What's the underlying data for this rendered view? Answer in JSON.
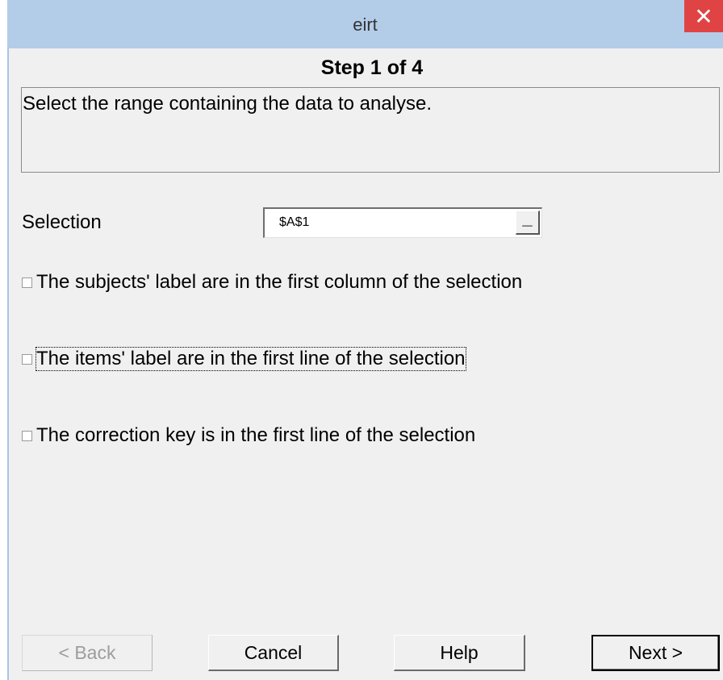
{
  "window": {
    "title": "eirt",
    "close_glyph": "✕"
  },
  "wizard": {
    "step_heading": "Step 1 of 4",
    "description": "Select the range containing the data to analyse."
  },
  "selection": {
    "label": "Selection",
    "value": "$A$1",
    "button_glyph": "_"
  },
  "options": [
    {
      "label": "The subjects' label are in the first column of the selection",
      "checked": false
    },
    {
      "label": "The items' label are in the first line of the selection",
      "checked": false,
      "focused": true
    },
    {
      "label": "The correction key is in the first line of the selection",
      "checked": false
    }
  ],
  "buttons": {
    "back": "< Back",
    "cancel": "Cancel",
    "help": "Help",
    "next": "Next >"
  },
  "colors": {
    "titlebar": "#b3cde9",
    "close": "#e04343",
    "dialog_bg": "#f0f0f0"
  }
}
